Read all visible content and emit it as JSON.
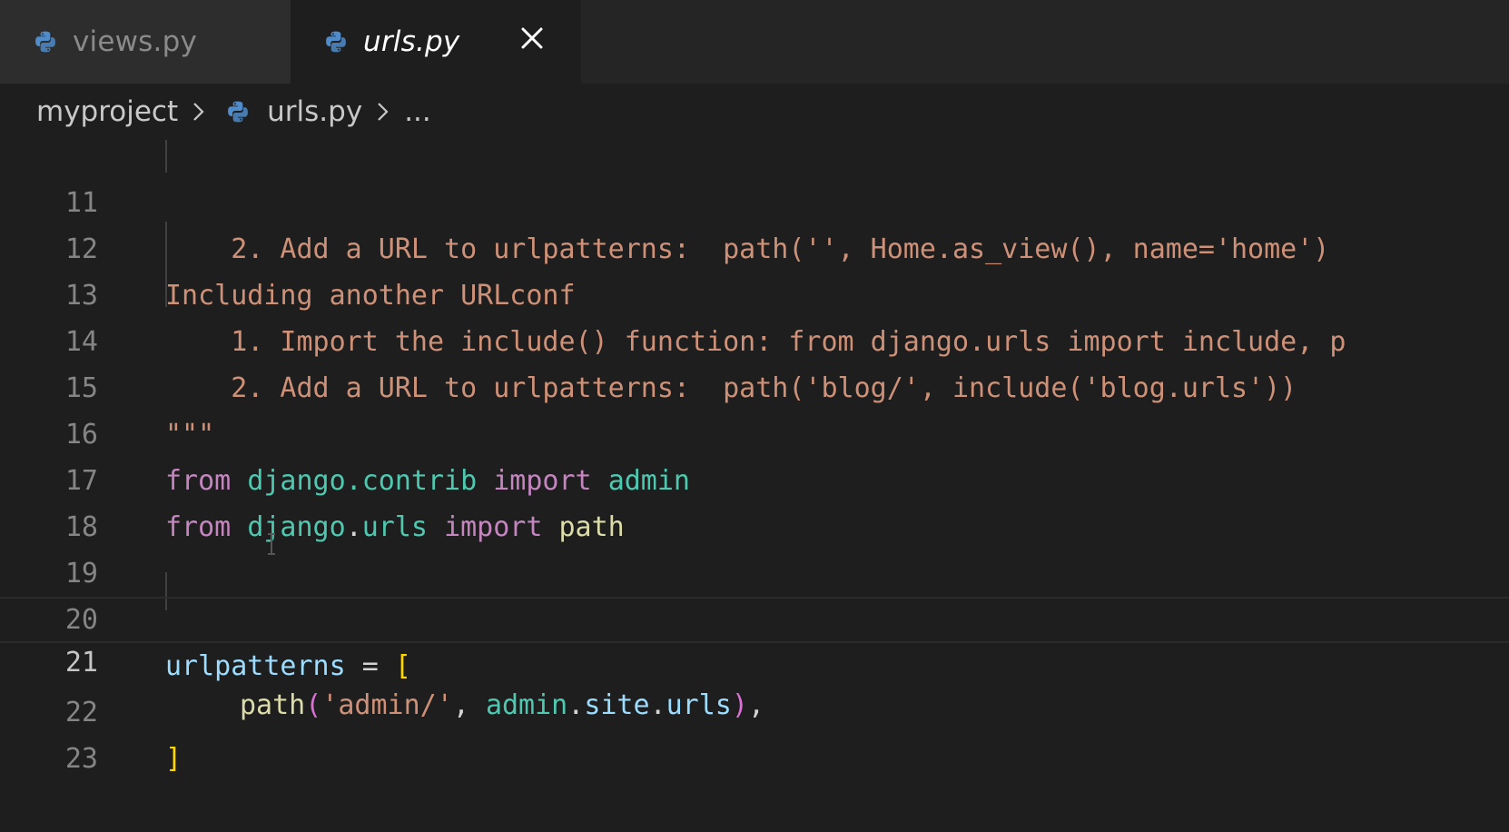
{
  "tabs": [
    {
      "name": "views.py",
      "active": false
    },
    {
      "name": "urls.py",
      "active": true
    }
  ],
  "breadcrumb": {
    "project": "myproject",
    "file": "urls.py",
    "more": "..."
  },
  "editor": {
    "current_line": 21,
    "lines": [
      {
        "num": "11",
        "text": "    2. Add a URL to urlpatterns:  path('', Home.as_view(), name='home')"
      },
      {
        "num": "12",
        "text": "Including another URLconf"
      },
      {
        "num": "13",
        "text": "    1. Import the include() function: from django.urls import include, p"
      },
      {
        "num": "14",
        "text": "    2. Add a URL to urlpatterns:  path('blog/', include('blog.urls'))"
      },
      {
        "num": "15",
        "text": "\"\"\""
      },
      {
        "num": "16",
        "tokens": {
          "kw1": "from",
          "mod": "django.contrib",
          "kw2": "import",
          "name": "admin"
        }
      },
      {
        "num": "17",
        "tokens": {
          "kw1": "from",
          "mod1": "django",
          "dot": ".",
          "mod2": "urls",
          "kw2": "import",
          "name": "path"
        }
      },
      {
        "num": "18",
        "text": ""
      },
      {
        "num": "19",
        "text": ""
      },
      {
        "num": "20",
        "tokens": {
          "var": "urlpatterns",
          "op": " = ",
          "br": "["
        }
      },
      {
        "num": "21",
        "tokens": {
          "fn": "path",
          "open": "(",
          "str": "'admin/'",
          "comma": ", ",
          "obj1": "admin",
          "dot1": ".",
          "obj2": "site",
          "dot2": ".",
          "obj3": "urls",
          "close": ")",
          "tail": ","
        }
      },
      {
        "num": "22",
        "tokens": {
          "br": "]"
        }
      },
      {
        "num": "23",
        "text": ""
      }
    ]
  },
  "colors": {
    "string": "#ce9178",
    "keyword": "#c586c0",
    "module": "#4ec9b0",
    "variable": "#9cdcfe",
    "function": "#dcdcaa",
    "bracket": "#ffd700"
  }
}
